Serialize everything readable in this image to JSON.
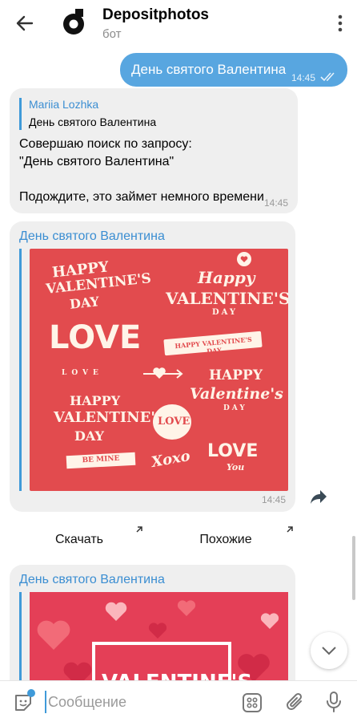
{
  "header": {
    "title": "Depositphotos",
    "subtitle": "бот"
  },
  "outgoing": {
    "text": "День святого Валентина",
    "time": "14:45"
  },
  "bot_reply": {
    "quote_name": "Mariia Lozhka",
    "quote_text": "День святого Валентина",
    "text": "Совершаю поиск по запросу:\n\"День святого Валентина\"\n\nПодождите, это займет немного времени",
    "time": "14:45"
  },
  "result1": {
    "title": "День святого Валентина",
    "time": "14:45",
    "image": {
      "happy1": "HAPPY",
      "valentines1": "VALENTINE'S",
      "day1": "DAY",
      "happy2": "Happy",
      "valentines2": "VALENTINE'S",
      "day2": "DAY",
      "love": "LOVE",
      "ribbon": "HAPPY VALENTINE'S DAY",
      "love_hearts": "LOVE",
      "happy3": "HAPPY",
      "valentines3": "Valentine's",
      "day3": "DAY",
      "happy4": "HAPPY",
      "valentines4": "VALENTINE'S",
      "day4": "DAY",
      "love_badge": "LOVE",
      "be_mine": "BE MINE",
      "xoxo": "Xoxo",
      "love_you_1": "LOVE",
      "love_you_2": "You"
    }
  },
  "buttons": {
    "download": "Скачать",
    "similar": "Похожие"
  },
  "result2": {
    "title": "День святого Валентина",
    "image_text": "VALENTINE'S"
  },
  "input": {
    "placeholder": "Сообщение"
  },
  "colors": {
    "accent": "#3f9ad9",
    "outgoing_bubble": "#58a6e0",
    "incoming_bubble": "#efefef",
    "image_red": "#e24b4e"
  }
}
